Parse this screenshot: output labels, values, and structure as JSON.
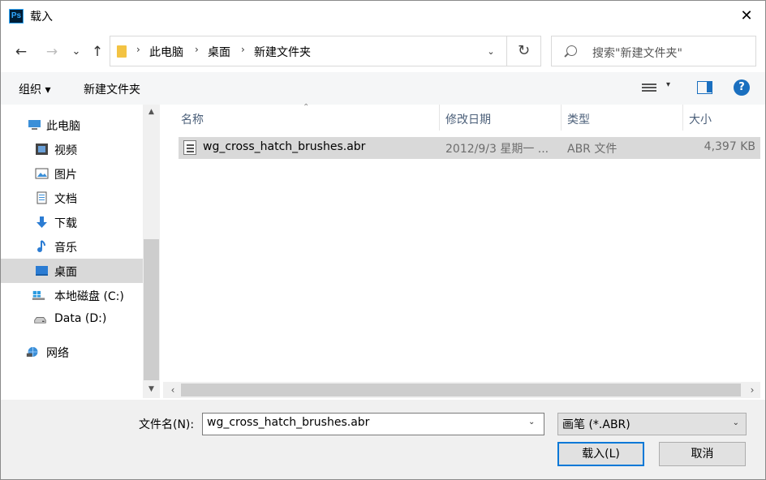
{
  "window": {
    "title": "载入",
    "app_icon_text": "Ps",
    "close": "✕"
  },
  "nav": {
    "back": "←",
    "forward": "→",
    "recent": "⌄",
    "up": "↑",
    "breadcrumb": [
      "此电脑",
      "桌面",
      "新建文件夹"
    ],
    "breadcrumb_sep": "›",
    "address_dropdown": "⌄",
    "refresh": "↻",
    "search_placeholder": "搜索\"新建文件夹\""
  },
  "toolbar": {
    "organize": "组织 ▾",
    "new_folder": "新建文件夹",
    "view_drop": "▾",
    "help": "?"
  },
  "sidebar": {
    "items": [
      {
        "label": "此电脑",
        "icon": "computer-icon"
      },
      {
        "label": "视频",
        "icon": "video-icon"
      },
      {
        "label": "图片",
        "icon": "picture-icon"
      },
      {
        "label": "文档",
        "icon": "document-icon"
      },
      {
        "label": "下载",
        "icon": "download-icon"
      },
      {
        "label": "音乐",
        "icon": "music-icon"
      },
      {
        "label": "桌面",
        "icon": "desktop-icon",
        "selected": true
      },
      {
        "label": "本地磁盘 (C:)",
        "icon": "windows-drive-icon"
      },
      {
        "label": "Data (D:)",
        "icon": "drive-icon"
      },
      {
        "label": "网络",
        "icon": "network-icon"
      }
    ],
    "scroll_up": "▲",
    "scroll_down": "▼"
  },
  "filelist": {
    "columns": {
      "name": "名称",
      "date": "修改日期",
      "type": "类型",
      "size": "大小"
    },
    "sort_arrow": "⌃",
    "rows": [
      {
        "name": "wg_cross_hatch_brushes.abr",
        "date": "2012/9/3 星期一 ...",
        "type": "ABR 文件",
        "size": "4,397 KB"
      }
    ],
    "scroll_left": "‹",
    "scroll_right": "›"
  },
  "bottom": {
    "filename_label": "文件名(N):",
    "filename_value": "wg_cross_hatch_brushes.abr",
    "filename_drop": "⌄",
    "filetype": "画笔 (*.ABR)",
    "filetype_drop": "⌄",
    "load_button": "载入(L)",
    "cancel_button": "取消"
  },
  "colors": {
    "accent": "#0078d7",
    "selected": "#d9d9d9",
    "header_text": "#4c607a"
  }
}
